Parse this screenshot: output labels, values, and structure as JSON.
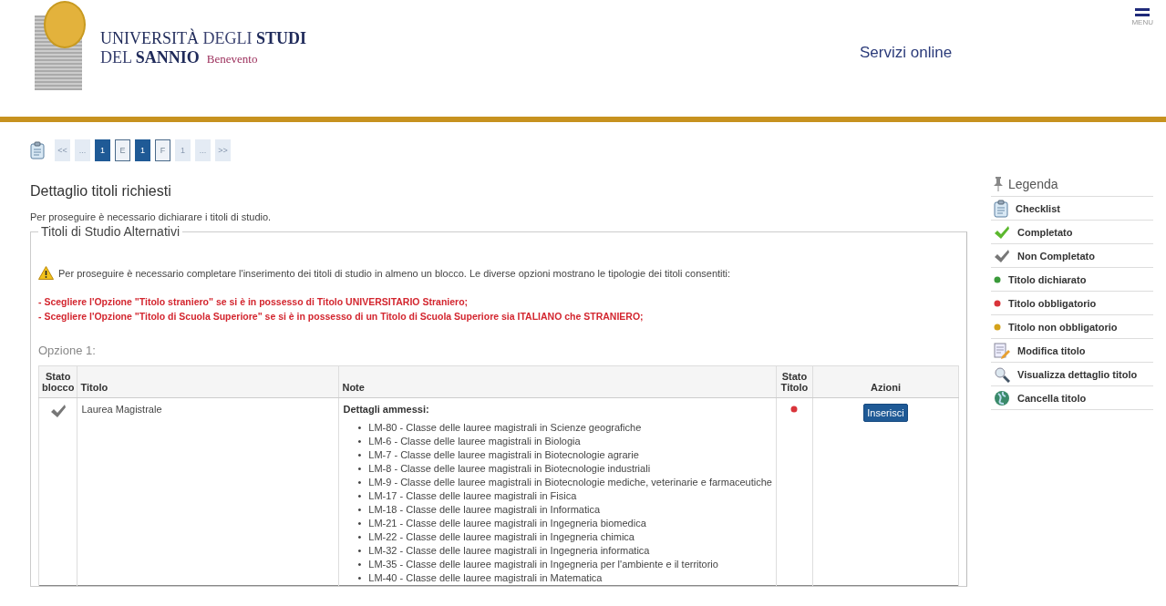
{
  "header": {
    "logo_line1_regular": "UNIVERSITÀ",
    "logo_line1_light": "DEGLI",
    "logo_line1_bold": "STUDI",
    "logo_line2_light": "DEL",
    "logo_line2_bold": "SANNIO",
    "logo_city": "Benevento",
    "service": "Servizi online",
    "menu_label": "MENU"
  },
  "steps": [
    {
      "label": "<<",
      "kind": "plain"
    },
    {
      "label": "...",
      "kind": "plain"
    },
    {
      "label": "1",
      "kind": "filled"
    },
    {
      "label": "E",
      "kind": "outline"
    },
    {
      "label": "1",
      "kind": "filled"
    },
    {
      "label": "F",
      "kind": "outline"
    },
    {
      "label": "1",
      "kind": "plain"
    },
    {
      "label": "...",
      "kind": "plain"
    },
    {
      "label": ">>",
      "kind": "plain"
    }
  ],
  "page_title": "Dettaglio titoli richiesti",
  "intro": "Per proseguire è necessario dichiarare i titoli di studio.",
  "fieldset": {
    "legend": "Titoli di Studio Alternativi",
    "warning": "Per proseguire è necessario completare l'inserimento dei titoli di studio in almeno un blocco. Le diverse opzioni mostrano le tipologie dei titoli consentiti:",
    "notes": [
      "- Scegliere l'Opzione \"Titolo straniero\" se si è in possesso di Titolo UNIVERSITARIO Straniero;",
      "- Scegliere l'Opzione \"Titolo di Scuola Superiore\" se si è in possesso di un Titolo di Scuola Superiore sia ITALIANO che STRANIERO;"
    ],
    "option_label": "Opzione 1:",
    "table": {
      "columns": [
        "Stato blocco",
        "Titolo",
        "Note",
        "Stato Titolo",
        "Azioni"
      ],
      "rows": [
        {
          "completed": false,
          "title": "Laurea Magistrale",
          "notes_heading": "Dettagli ammessi:",
          "notes_items": [
            "LM-80 - Classe delle lauree magistrali in Scienze geografiche",
            "LM-6 - Classe delle lauree magistrali in Biologia",
            "LM-7 - Classe delle lauree magistrali in Biotecnologie agrarie",
            "LM-8 - Classe delle lauree magistrali in Biotecnologie industriali",
            "LM-9 - Classe delle lauree magistrali in Biotecnologie mediche, veterinarie e farmaceutiche",
            "LM-17 - Classe delle lauree magistrali in Fisica",
            "LM-18 - Classe delle lauree magistrali in Informatica",
            "LM-21 - Classe delle lauree magistrali in Ingegneria biomedica",
            "LM-22 - Classe delle lauree magistrali in Ingegneria chimica",
            "LM-32 - Classe delle lauree magistrali in Ingegneria informatica",
            "LM-35 - Classe delle lauree magistrali in Ingegneria per l'ambiente e il territorio",
            "LM-40 - Classe delle lauree magistrali in Matematica"
          ],
          "list_marker": "•",
          "color": "#d9343a",
          "action": "Inserisci"
        }
      ]
    }
  },
  "legend": {
    "title": "Legenda",
    "items": [
      {
        "label": "Checklist",
        "kind": "checklist"
      },
      {
        "label": "Completato",
        "kind": "done"
      },
      {
        "label": "Non Completato",
        "kind": "not-done"
      },
      {
        "label": "Titolo dichiarato",
        "kind": "dot",
        "color": "#3a9a3a"
      },
      {
        "label": "Titolo obbligatorio",
        "kind": "dot",
        "color": "#d9343a"
      },
      {
        "label": "Titolo non obbligatorio",
        "kind": "dot",
        "color": "#d4a21a"
      },
      {
        "label": "Modifica titolo",
        "kind": "edit"
      },
      {
        "label": "Visualizza dettaglio titolo",
        "kind": "view"
      },
      {
        "label": "Cancella titolo",
        "kind": "delete"
      }
    ]
  }
}
